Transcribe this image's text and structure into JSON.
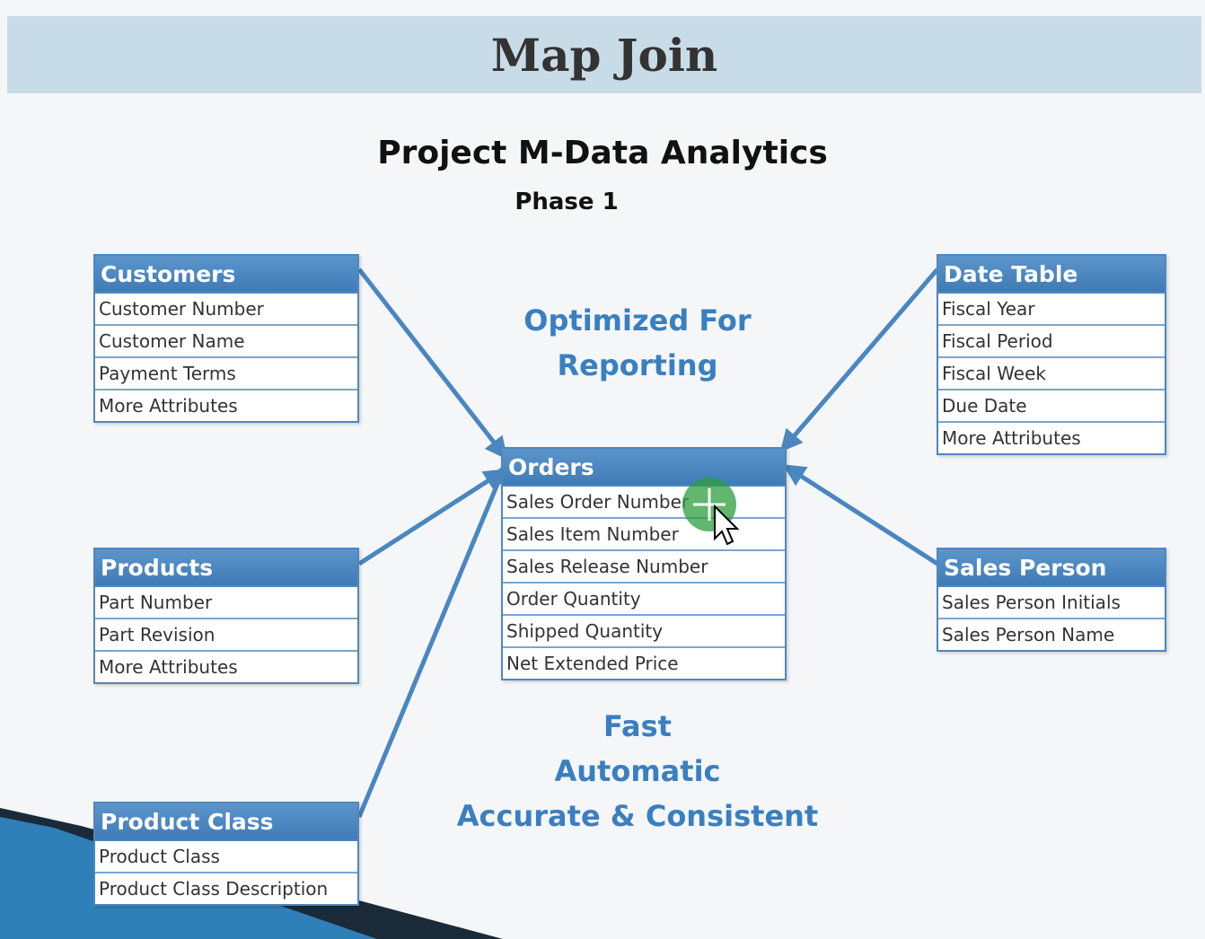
{
  "title": "Map Join",
  "heading": "Project M-Data Analytics",
  "subheading": "Phase 1",
  "optimized_line1": "Optimized For",
  "optimized_line2": "Reporting",
  "benefits": [
    "Fast",
    "Automatic",
    "Accurate & Consistent"
  ],
  "colors": {
    "header": "#4a86c0",
    "accent_text": "#3a7fc0",
    "arrow": "#4a86c0"
  },
  "tables": {
    "customers": {
      "title": "Customers",
      "rows": [
        "Customer Number",
        "Customer Name",
        "Payment Terms",
        "More Attributes"
      ]
    },
    "products": {
      "title": "Products",
      "rows": [
        "Part Number",
        "Part Revision",
        "More Attributes"
      ]
    },
    "product_class": {
      "title": "Product Class",
      "rows": [
        "Product Class",
        "Product Class Description"
      ]
    },
    "date_table": {
      "title": "Date Table",
      "rows": [
        "Fiscal Year",
        "Fiscal Period",
        "Fiscal Week",
        "Due Date",
        "More Attributes"
      ]
    },
    "sales_person": {
      "title": "Sales Person",
      "rows": [
        "Sales Person Initials",
        "Sales Person Name"
      ]
    },
    "orders": {
      "title": "Orders",
      "rows": [
        "Sales Order Number",
        "Sales Item Number",
        "Sales Release Number",
        "Order Quantity",
        "Shipped Quantity",
        "Net Extended Price"
      ]
    }
  }
}
